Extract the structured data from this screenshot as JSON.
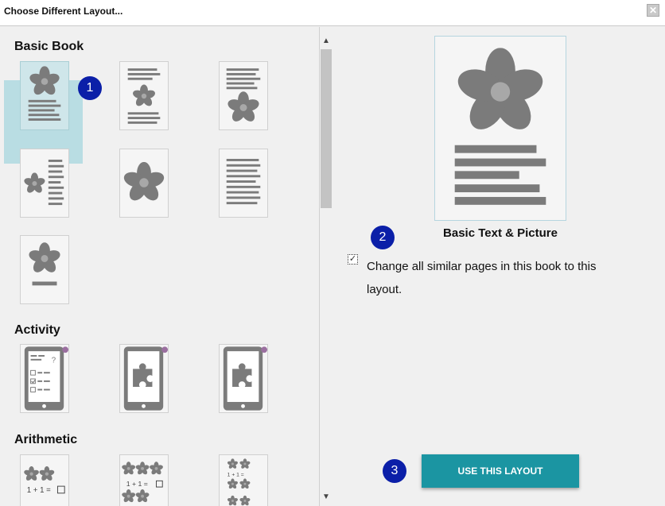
{
  "window": {
    "title": "Choose Different Layout...",
    "close_icon": "close-icon"
  },
  "left_panel": {
    "sections": [
      {
        "heading": "Basic Book"
      },
      {
        "heading": "Activity"
      },
      {
        "heading": "Arithmetic"
      }
    ],
    "arithmetic_thumbs": {
      "t1": "1 + 1 =",
      "t2": "1 + 1 =",
      "t3": "1 + 1 ="
    }
  },
  "preview": {
    "layout_name": "Basic Text & Picture",
    "checkbox_checked": true,
    "checkbox_label": "Change all similar pages in this book to this layout."
  },
  "actions": {
    "use_layout": "USE THIS LAYOUT"
  },
  "callouts": {
    "b1": "1",
    "b2": "2",
    "b3": "3"
  },
  "colors": {
    "accent_button": "#1b95a2",
    "badge": "#0b1fa8",
    "selection": "#b9dde3",
    "activity_dot": "#9b6fa0"
  }
}
